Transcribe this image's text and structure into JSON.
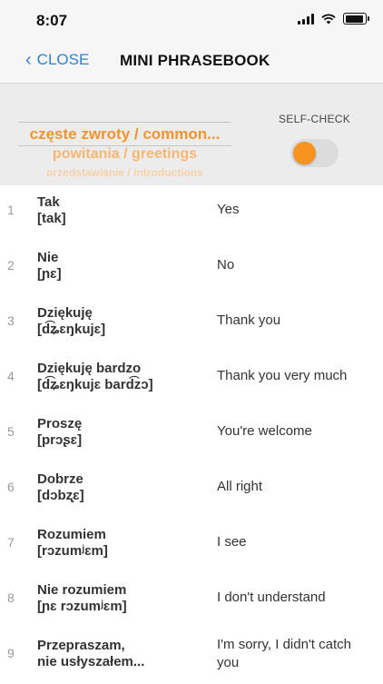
{
  "status": {
    "time": "8:07"
  },
  "nav": {
    "back_label": "CLOSE",
    "title": "MINI PHRASEBOOK"
  },
  "filter": {
    "selected_category": "częste zwroty / common...",
    "next_category": "powitania / greetings",
    "third_category": "przedstawianie / introductions"
  },
  "self_check": {
    "label": "SELF-CHECK",
    "enabled": false
  },
  "colors": {
    "accent": "#f7931e",
    "link": "#2f7fd6"
  },
  "phrases": [
    {
      "num": "1",
      "polish": "Tak",
      "ipa": "[tak]",
      "english": "Yes"
    },
    {
      "num": "2",
      "polish": "Nie",
      "ipa": "[ɲɛ]",
      "english": "No"
    },
    {
      "num": "3",
      "polish": "Dziękuję",
      "ipa": "[d͡ʑɛŋkujɛ]",
      "english": "Thank you"
    },
    {
      "num": "4",
      "polish": "Dziękuję bardzo",
      "ipa": "[d͡ʑɛŋkujɛ bard͡zɔ]",
      "english": "Thank you very much"
    },
    {
      "num": "5",
      "polish": "Proszę",
      "ipa": "[prɔʂɛ]",
      "english": "You're welcome"
    },
    {
      "num": "6",
      "polish": "Dobrze",
      "ipa": "[dɔbʐɛ]",
      "english": "All right"
    },
    {
      "num": "7",
      "polish": "Rozumiem",
      "ipa": "[rɔzumʲɛm]",
      "english": "I see"
    },
    {
      "num": "8",
      "polish": "Nie rozumiem",
      "ipa": "[ɲɛ rɔzumʲɛm]",
      "english": "I don't understand"
    },
    {
      "num": "9",
      "polish": "Przepraszam,",
      "ipa": "nie usłyszałem...",
      "english": "I'm sorry, I didn't catch you"
    }
  ]
}
